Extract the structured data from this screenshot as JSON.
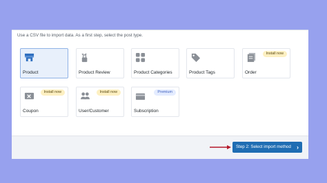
{
  "intro_text": "Use a CSV file to import data. As a first step, select the post type.",
  "post_types": [
    {
      "label": "Product",
      "icon": "product-icon",
      "badge": "",
      "selected": true
    },
    {
      "label": "Product Review",
      "icon": "review-icon",
      "badge": "",
      "selected": false
    },
    {
      "label": "Product Categories",
      "icon": "categories-icon",
      "badge": "",
      "selected": false
    },
    {
      "label": "Product Tags",
      "icon": "tag-icon",
      "badge": "",
      "selected": false
    },
    {
      "label": "Order",
      "icon": "order-icon",
      "badge": "Install now",
      "selected": false
    },
    {
      "label": "Coupon",
      "icon": "coupon-icon",
      "badge": "Install now",
      "selected": false
    },
    {
      "label": "User/Customer",
      "icon": "users-icon",
      "badge": "Install now",
      "selected": false
    },
    {
      "label": "Subscription",
      "icon": "subscription-icon",
      "badge": "Premium",
      "selected": false
    }
  ],
  "footer": {
    "next_button_label": "Step 2: Select import method",
    "next_button_icon": "chevron-right-icon"
  },
  "colors": {
    "background": "#97a1ee",
    "accent": "#1f6db3",
    "arrow": "#b5182a",
    "selected_card": "#e8f0fb"
  }
}
